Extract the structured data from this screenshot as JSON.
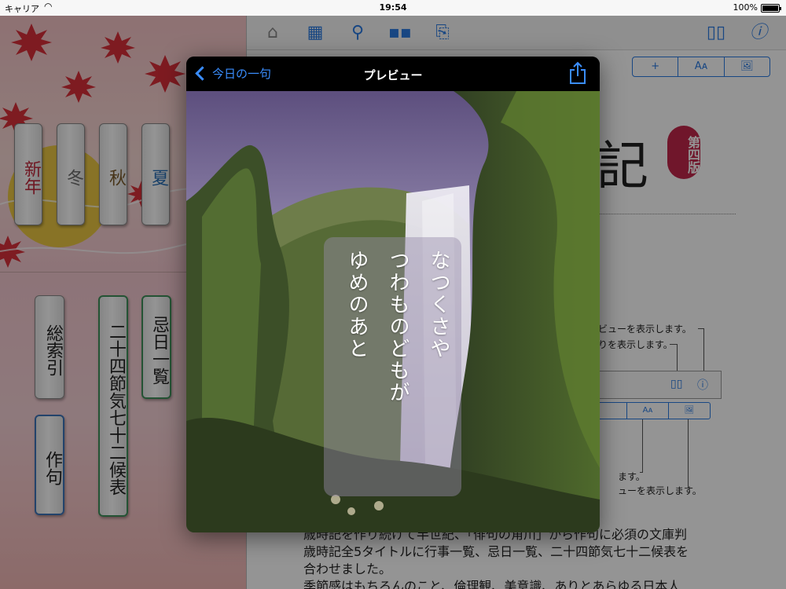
{
  "status_bar": {
    "carrier": "キャリア",
    "time": "19:54",
    "battery": "100%"
  },
  "left_pane": {
    "seasons": [
      "新年",
      "冬",
      "秋",
      "夏"
    ],
    "menus": [
      "総索引",
      "作句",
      "二十四節気七十二候表",
      "忌日一覧"
    ]
  },
  "right_pane": {
    "toolbar_icons": [
      "home-icon",
      "grid-icon",
      "search-icon",
      "tiles-icon",
      "bookmark-icon",
      "book-icon",
      "info-icon"
    ],
    "segmented": [
      "+",
      "Aᴀ",
      "🖼"
    ],
    "title_fragment": "記",
    "edition": "第四版",
    "help_lines": [
      "ビューを表示します。",
      "りを表示します。",
      "ます。",
      "ューを表示します。"
    ],
    "body_lines": [
      "歳時記を作り続けて半世紀、「俳句の角川」から作句に必須の文庫判",
      "歳時記全5タイトルに行事一覧、忌日一覧、二十四節気七十二候表を",
      "合わせました。",
      "季節感はもちろんのこと、倫理観、美意識、ありとあらゆる日本人"
    ]
  },
  "modal": {
    "back_label": "今日の一句",
    "title": "プレビュー",
    "haiku": [
      "なつくさや",
      "つわものどもが",
      "ゆめのあと"
    ]
  },
  "colors": {
    "accent": "#3a8dfe",
    "badge": "#c2264a",
    "season_red": "#c0283c"
  }
}
